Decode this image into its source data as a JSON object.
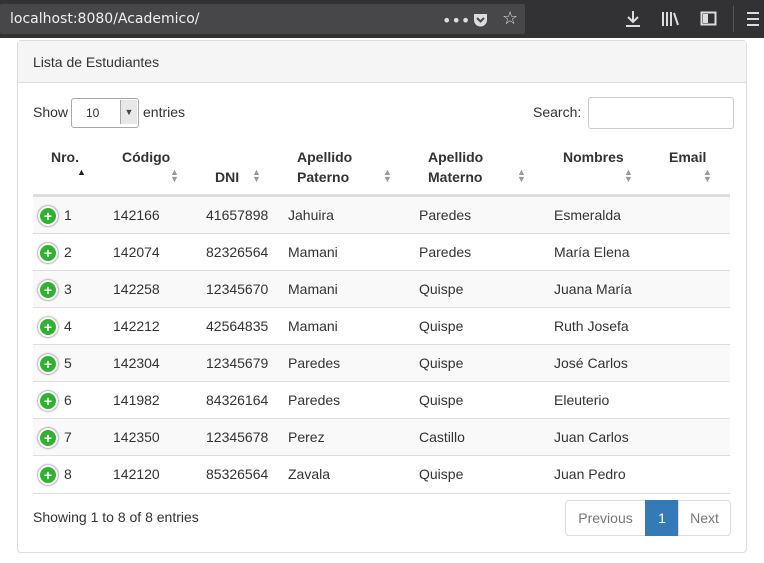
{
  "browser": {
    "url": "localhost:8080/Academico/",
    "icons": [
      "more-icon",
      "pocket-icon",
      "bookmark-star-icon",
      "download-icon",
      "library-icon",
      "sidebar-icon",
      "menu-icon"
    ]
  },
  "panel": {
    "title": "Lista de Estudiantes"
  },
  "length": {
    "show_label": "Show",
    "value": "10",
    "entries_label": "entries"
  },
  "search": {
    "label": "Search:",
    "value": ""
  },
  "table": {
    "columns": [
      {
        "line1": "Nro.",
        "line2": ""
      },
      {
        "line1": "Código",
        "line2": ""
      },
      {
        "line1": "DNI",
        "line2": ""
      },
      {
        "line1": "Apellido",
        "line2": "Paterno"
      },
      {
        "line1": "Apellido",
        "line2": "Materno"
      },
      {
        "line1": "Nombres",
        "line2": ""
      },
      {
        "line1": "Email",
        "line2": ""
      }
    ],
    "sorted_column": "Nro.",
    "sort_direction": "asc",
    "rows": [
      {
        "nro": "1",
        "codigo": "142166",
        "dni": "41657898",
        "paterno": "Jahuira",
        "materno": "Paredes",
        "nombres": "Esmeralda",
        "email": ""
      },
      {
        "nro": "2",
        "codigo": "142074",
        "dni": "82326564",
        "paterno": "Mamani",
        "materno": "Paredes",
        "nombres": "María Elena",
        "email": ""
      },
      {
        "nro": "3",
        "codigo": "142258",
        "dni": "12345670",
        "paterno": "Mamani",
        "materno": "Quispe",
        "nombres": "Juana María",
        "email": ""
      },
      {
        "nro": "4",
        "codigo": "142212",
        "dni": "42564835",
        "paterno": "Mamani",
        "materno": "Quispe",
        "nombres": "Ruth Josefa",
        "email": ""
      },
      {
        "nro": "5",
        "codigo": "142304",
        "dni": "12345679",
        "paterno": "Paredes",
        "materno": "Quispe",
        "nombres": "José Carlos",
        "email": ""
      },
      {
        "nro": "6",
        "codigo": "141982",
        "dni": "84326164",
        "paterno": "Paredes",
        "materno": "Quispe",
        "nombres": "Eleuterio",
        "email": ""
      },
      {
        "nro": "7",
        "codigo": "142350",
        "dni": "12345678",
        "paterno": "Perez",
        "materno": "Castillo",
        "nombres": "Juan Carlos",
        "email": ""
      },
      {
        "nro": "8",
        "codigo": "142120",
        "dni": "85326564",
        "paterno": "Zavala",
        "materno": "Quispe",
        "nombres": "Juan Pedro",
        "email": ""
      }
    ]
  },
  "info": "Showing 1 to 8 of 8 entries",
  "pagination": {
    "previous": "Previous",
    "current": "1",
    "next": "Next"
  },
  "colors": {
    "accent": "#337ab7",
    "expand_button": "#31b131",
    "stripe": "#f9f9f9"
  }
}
